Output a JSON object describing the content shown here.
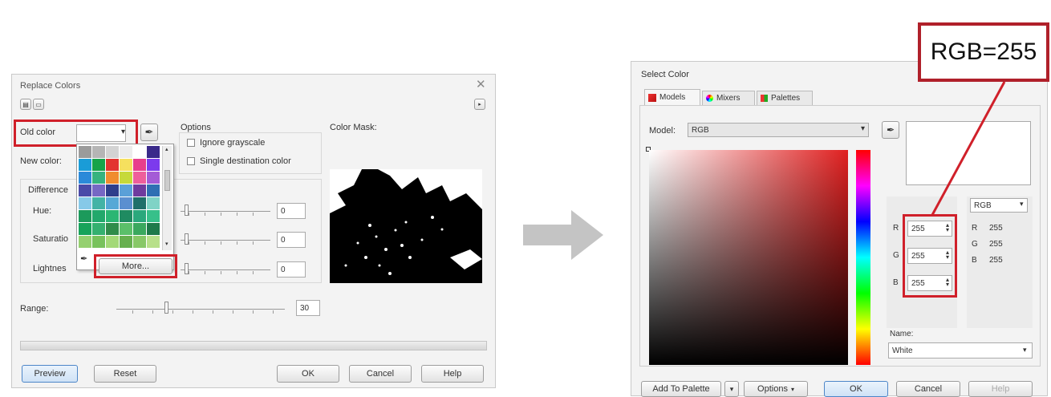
{
  "replace_dialog": {
    "title": "Replace Colors",
    "old_color_label": "Old color",
    "new_color_label": "New color:",
    "options_label": "Options",
    "ignore_grayscale": "Ignore grayscale",
    "single_destination": "Single destination color",
    "color_mask_label": "Color Mask:",
    "differences_label": "Difference",
    "hue_label": "Hue:",
    "saturation_label": "Saturatio",
    "lightness_label": "Lightnes",
    "hue_value": "0",
    "saturation_value": "0",
    "lightness_value": "0",
    "range_label": "Range:",
    "range_value": "30",
    "more_button": "More...",
    "preview_button": "Preview",
    "reset_button": "Reset",
    "ok_button": "OK",
    "cancel_button": "Cancel",
    "help_button": "Help",
    "palette_colors": [
      "#9b9b9b",
      "#b5b5b5",
      "#d3d3d3",
      "#ececec",
      "#ffffff",
      "#3a2a8a",
      "#1a9cd7",
      "#16a34a",
      "#e3342f",
      "#f6e05e",
      "#e83e8c",
      "#7c3aed",
      "#2b8ad9",
      "#36b37e",
      "#f08c2e",
      "#c6d93a",
      "#ee5f9b",
      "#a45bd6",
      "#4a4aa8",
      "#7668c4",
      "#2e3e8c",
      "#5aa0d8",
      "#6f3b9e",
      "#2f6fb3",
      "#86c9e8",
      "#43b3a6",
      "#56a8d6",
      "#5b8fd0",
      "#1f6f6a",
      "#7fd3c6",
      "#1c9a5b",
      "#22a86b",
      "#2bb673",
      "#1f8b61",
      "#2aa87c",
      "#37c08a",
      "#17a35a",
      "#34b06f",
      "#2f8c4a",
      "#5bbf6a",
      "#3aa85e",
      "#1e7a4a",
      "#95d070",
      "#78c25c",
      "#a3d977",
      "#67b04f",
      "#88c867",
      "#b8e08a"
    ]
  },
  "select_dialog": {
    "title": "Select Color",
    "tab_models": "Models",
    "tab_mixers": "Mixers",
    "tab_palettes": "Palettes",
    "model_label": "Model:",
    "model_value": "RGB",
    "r_label": "R",
    "g_label": "G",
    "b_label": "B",
    "r_value": "255",
    "g_value": "255",
    "b_value": "255",
    "mode_value": "RGB",
    "readout_r_label": "R",
    "readout_g_label": "G",
    "readout_b_label": "B",
    "readout_r": "255",
    "readout_g": "255",
    "readout_b": "255",
    "name_label": "Name:",
    "name_value": "White",
    "add_to_palette": "Add To Palette",
    "options_button": "Options",
    "ok_button": "OK",
    "cancel_button": "Cancel",
    "help_button": "Help"
  },
  "callout": {
    "text": "RGB=255"
  }
}
